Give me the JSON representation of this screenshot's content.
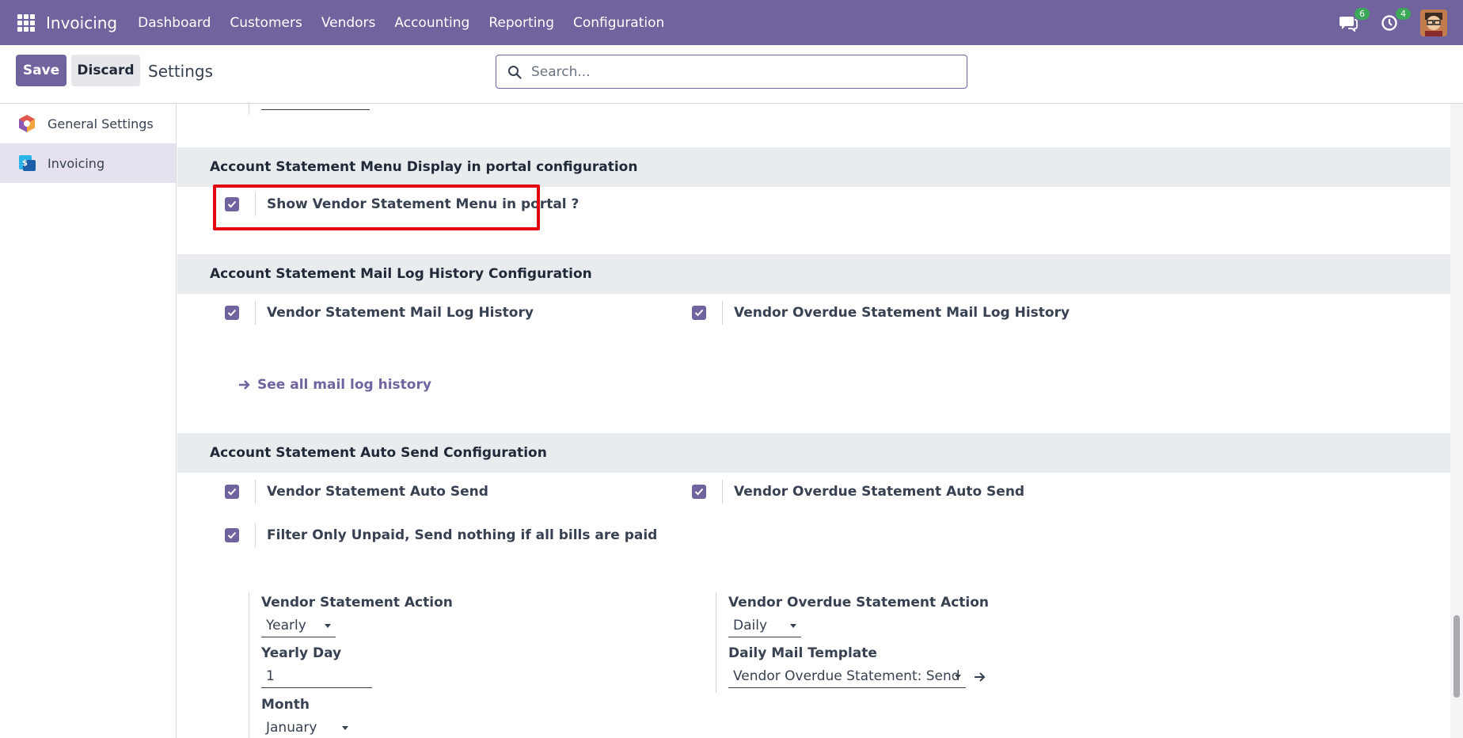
{
  "navbar": {
    "brand": "Invoicing",
    "menu": [
      "Dashboard",
      "Customers",
      "Vendors",
      "Accounting",
      "Reporting",
      "Configuration"
    ],
    "messages_badge": "6",
    "activities_badge": "4"
  },
  "control": {
    "save_label": "Save",
    "discard_label": "Discard",
    "breadcrumb": "Settings",
    "search_placeholder": "Search..."
  },
  "sidebar": {
    "items": [
      {
        "label": "General Settings",
        "active": false
      },
      {
        "label": "Invoicing",
        "active": true
      }
    ]
  },
  "sections": {
    "portal": {
      "title": "Account Statement Menu Display in portal configuration",
      "show_vendor_menu": "Show Vendor Statement Menu in portal ?"
    },
    "mail_log": {
      "title": "Account Statement Mail Log History Configuration",
      "vendor_log": "Vendor Statement Mail Log History",
      "vendor_overdue_log": "Vendor Overdue Statement Mail Log History",
      "see_all_link": "See all mail log history"
    },
    "auto_send": {
      "title": "Account Statement Auto Send Configuration",
      "vendor_auto": "Vendor Statement Auto Send",
      "vendor_overdue_auto": "Vendor Overdue Statement Auto Send",
      "filter_unpaid": "Filter Only Unpaid, Send nothing if all bills are paid",
      "vendor_action_label": "Vendor Statement Action",
      "vendor_action_value": "Yearly",
      "yearly_day_label": "Yearly Day",
      "yearly_day_value": "1",
      "month_label": "Month",
      "month_value": "January",
      "overdue_action_label": "Vendor Overdue Statement Action",
      "overdue_action_value": "Daily",
      "daily_template_label": "Daily Mail Template",
      "daily_template_value": "Vendor Overdue Statement: Send"
    }
  },
  "colors": {
    "navbar": "#71639e",
    "primary": "#71639e",
    "highlight": "#e3000f",
    "section_bg": "#e9ecef"
  }
}
